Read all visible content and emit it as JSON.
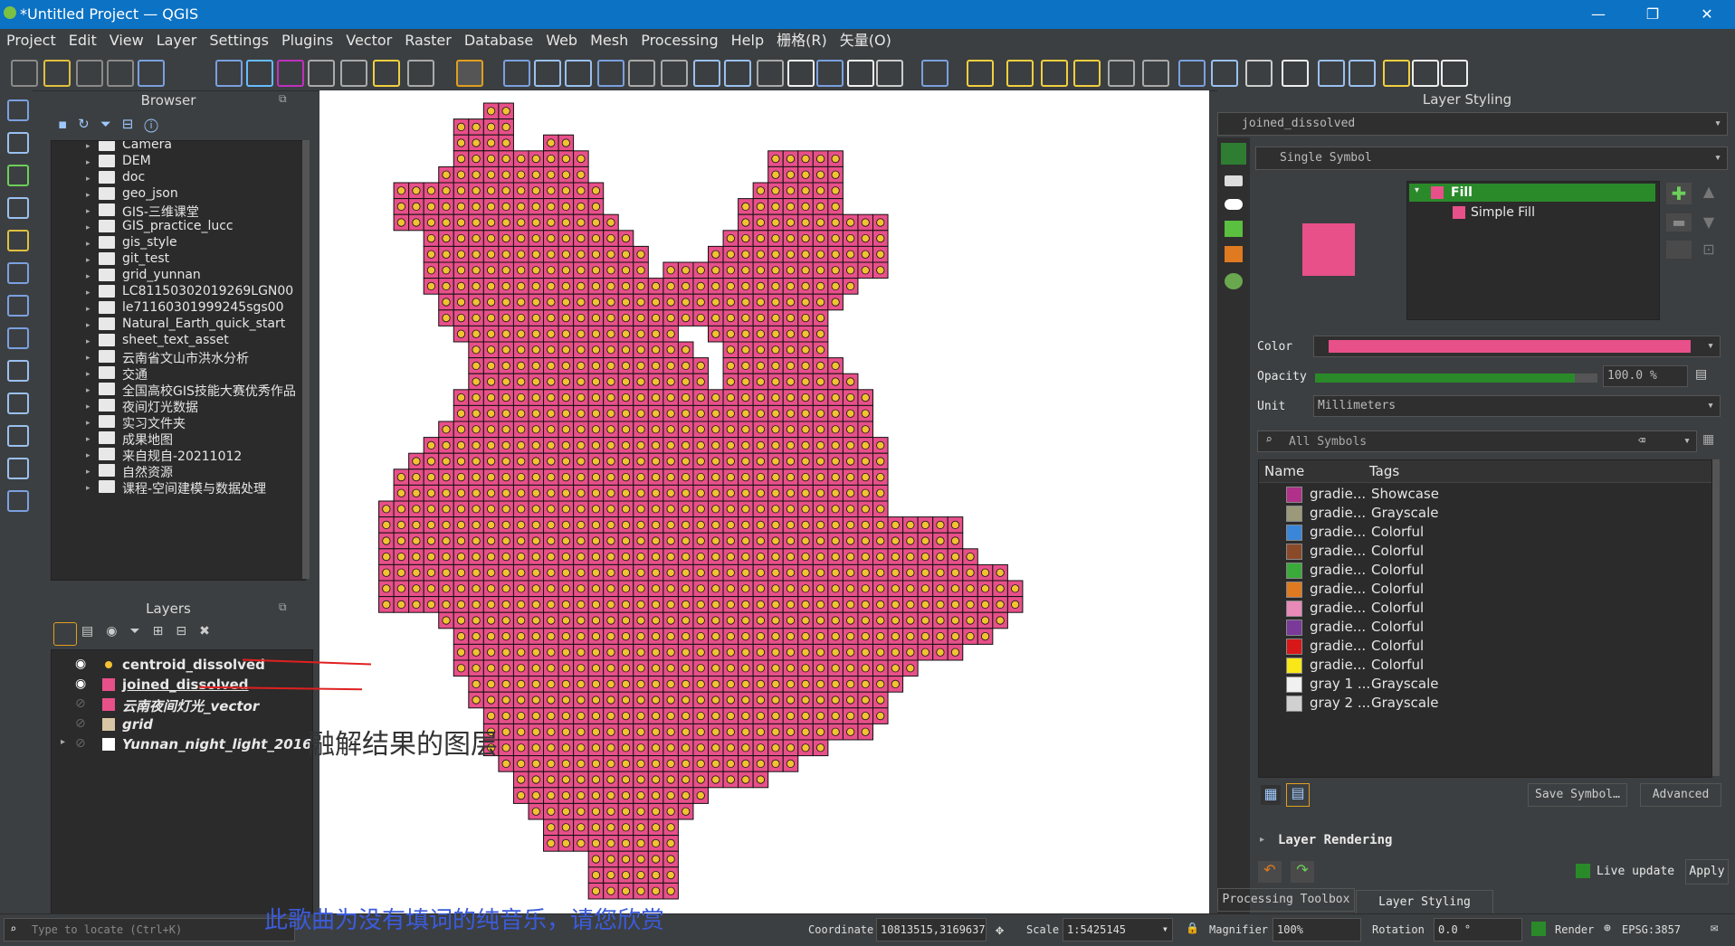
{
  "app": {
    "title": "*Untitled Project — QGIS",
    "win_controls": [
      "—",
      "❐",
      "✕"
    ]
  },
  "menu": [
    "Project",
    "Edit",
    "View",
    "Layer",
    "Settings",
    "Plugins",
    "Vector",
    "Raster",
    "Database",
    "Web",
    "Mesh",
    "Processing",
    "Help",
    "栅格(R)",
    "矢量(O)"
  ],
  "browser": {
    "title": "Browser",
    "items": [
      "Camera",
      "DEM",
      "doc",
      "geo_json",
      "GIS-三维课堂",
      "GIS_practice_lucc",
      "gis_style",
      "git_test",
      "grid_yunnan",
      "LC81150302019269LGN00",
      "le71160301999245sgs00",
      "Natural_Earth_quick_start",
      "sheet_text_asset",
      "云南省文山市洪水分析",
      "交通",
      "全国高校GIS技能大赛优秀作品",
      "夜间灯光数据",
      "实习文件夹",
      "成果地图",
      "来自规自-20211012",
      "自然资源",
      "课程-空间建模与数据处理"
    ]
  },
  "layers": {
    "title": "Layers",
    "items": [
      {
        "name": "centroid_dissolved",
        "color": "#f1c232"
      },
      {
        "name": "joined_dissolved",
        "color": "#e8508a"
      },
      {
        "name": "云南夜间灯光_vector",
        "color": "#e8508a"
      },
      {
        "name": "grid",
        "color": "#d8c6a4"
      },
      {
        "name": "Yunnan_night_light_2016",
        "color": "#ffffff"
      }
    ],
    "annotation": "融解结果的图层"
  },
  "styling": {
    "title": "Layer Styling",
    "layer": "joined_dissolved",
    "renderer": "Single Symbol",
    "tree_fill": "Fill",
    "tree_simple_fill": "Simple Fill",
    "color_label": "Color",
    "opacity_label": "Opacity",
    "opacity_value": "100.0 %",
    "opacity": 0.92,
    "unit_label": "Unit",
    "unit_value": "Millimeters",
    "search_placeholder": "All Symbols",
    "col_name": "Name",
    "col_tags": "Tags",
    "symbols": [
      {
        "name": "gradie...",
        "tag": "Showcase",
        "color": "#b0308a"
      },
      {
        "name": "gradie...",
        "tag": "Grayscale",
        "color": "#9a9a7a"
      },
      {
        "name": "gradie...",
        "tag": "Colorful",
        "color": "#3a86d8"
      },
      {
        "name": "gradie...",
        "tag": "Colorful",
        "color": "#8a4a2a"
      },
      {
        "name": "gradie...",
        "tag": "Colorful",
        "color": "#3aaa3a"
      },
      {
        "name": "gradie...",
        "tag": "Colorful",
        "color": "#e07a20"
      },
      {
        "name": "gradie...",
        "tag": "Colorful",
        "color": "#e88ab8"
      },
      {
        "name": "gradie...",
        "tag": "Colorful",
        "color": "#7a3a9a"
      },
      {
        "name": "gradie...",
        "tag": "Colorful",
        "color": "#d81818"
      },
      {
        "name": "gradie...",
        "tag": "Colorful",
        "color": "#f8e818"
      },
      {
        "name": "gray 1 ...",
        "tag": "Grayscale",
        "color": "#f0f0f0"
      },
      {
        "name": "gray 2 ...",
        "tag": "Grayscale",
        "color": "#d0d0d0"
      }
    ],
    "save_symbol": "Save Symbol…",
    "advanced": "Advanced",
    "layer_rendering": "Layer Rendering",
    "live_update": "Live update",
    "apply": "Apply",
    "tab_processing": "Processing Toolbox",
    "tab_styling": "Layer Styling",
    "fill_color": "#e8508a"
  },
  "status": {
    "locate_placeholder": "Type to locate (Ctrl+K)",
    "coordinate_label": "Coordinate",
    "coordinate": "10813515,3169637",
    "scale_label": "Scale",
    "scale": "1:5425145",
    "magnifier_label": "Magnifier",
    "magnifier": "100%",
    "rotation_label": "Rotation",
    "rotation": "0.0 °",
    "render_label": "Render",
    "crs": "EPSG:3857"
  },
  "subtitle": "此歌曲为没有填词的纯音乐，请您欣赏"
}
